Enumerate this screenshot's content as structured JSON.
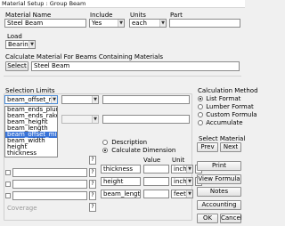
{
  "window": {
    "title": "Material Setup :  Group  Beam"
  },
  "header_labels": {
    "material_name": "Material Name",
    "include": "Include",
    "units": "Units",
    "part": "Part"
  },
  "material": {
    "name": "Steel Beam",
    "include": "Yes",
    "units": "each",
    "part": ""
  },
  "load": {
    "label": "Load",
    "value": "Bearing"
  },
  "calc_material": {
    "label": "Calculate Material For Beams Containing Materials",
    "select_button": "Select",
    "value": "Steel Beam"
  },
  "selection_limits": {
    "label": "Selection Limits",
    "combo1_value": "beam_offset_min",
    "dropdown_options": [
      "beam_ends_plumb",
      "beam_ends_raked",
      "beam_height",
      "beam_length",
      "beam_offset_min",
      "beam_width",
      "height",
      "thickness"
    ],
    "selected_option": "beam_offset_min",
    "coverage_label": "Coverage"
  },
  "calc_method": {
    "label": "Calculation Method",
    "options": [
      "List Format",
      "Lumber Format",
      "Custom Formula",
      "Accumulate"
    ],
    "selected": "List Format"
  },
  "select_material": {
    "label": "Select Material",
    "prev": "Prev",
    "next": "Next"
  },
  "dimension": {
    "description_label": "Description",
    "calculate_label": "Calculate Dimension",
    "value_header": "Value",
    "unit_header": "Unit",
    "rows": [
      {
        "name": "thickness",
        "unit": "inches"
      },
      {
        "name": "height",
        "unit": "inches"
      },
      {
        "name": "beam_length",
        "unit": "feet_inches"
      }
    ]
  },
  "question_mark": "?",
  "buttons": {
    "print": "Print",
    "view_formula": "View Formula",
    "notes": "Notes",
    "accounting": "Accounting",
    "ok": "OK",
    "cancel": "Cancel"
  }
}
